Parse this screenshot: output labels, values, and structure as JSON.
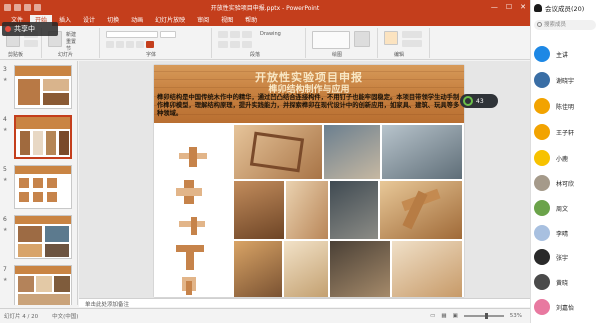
{
  "window": {
    "title": "开放性实验项目申报.pptx - PowerPoint",
    "controls": [
      "—",
      "☐",
      "✕"
    ]
  },
  "ribbon": {
    "tabs": [
      "文件",
      "开始",
      "插入",
      "设计",
      "切换",
      "动画",
      "幻灯片放映",
      "审阅",
      "视图",
      "帮助"
    ],
    "active_tab_index": 1,
    "group_labels": [
      "剪贴板",
      "幻灯片",
      "字体",
      "段落",
      "绘图",
      "编辑"
    ],
    "small_labels": [
      "新建",
      "重置",
      "节",
      "Drawing"
    ]
  },
  "live_badge": {
    "text": "共享中"
  },
  "thumbnails": [
    {
      "number": "3",
      "star": "★"
    },
    {
      "number": "4",
      "star": "★"
    },
    {
      "number": "5",
      "star": "★"
    },
    {
      "number": "6",
      "star": "★"
    },
    {
      "number": "7",
      "star": "★"
    }
  ],
  "slide": {
    "title_line1": "开放性实验项目申报",
    "title_line2": "榫卯结构制作与应用",
    "body": "榫卯结构是中国传统木作中的精华，通过凹凸结合连接构件，不用钉子也能牢固稳定。本项目带领学生动手制作榫卯模型，理解结构原理，提升实践能力，并探索榫卯在现代设计中的创新应用，如家具、建筑、玩具等多种领域。"
  },
  "clock": {
    "value": "43"
  },
  "notes": {
    "placeholder": "单击此处添加备注"
  },
  "status": {
    "left": "幻灯片 4 / 20",
    "language": "中文(中国)",
    "zoom": "53%"
  },
  "side_panel": {
    "title": "会议成员(20)",
    "search_placeholder": "搜索成员",
    "members": [
      {
        "name": "主讲",
        "color": "#1e88e5"
      },
      {
        "name": "谢晓宇",
        "color": "#3a6ea5"
      },
      {
        "name": "陈佳明",
        "color": "#f2a300"
      },
      {
        "name": "王子轩",
        "color": "#f2a300"
      },
      {
        "name": "小鹿",
        "color": "#f7c200"
      },
      {
        "name": "林可欣",
        "color": "#a59a8a"
      },
      {
        "name": "周文",
        "color": "#6ba34a"
      },
      {
        "name": "李晴",
        "color": "#a8c0e0"
      },
      {
        "name": "张宇",
        "color": "#2a2a2a"
      },
      {
        "name": "黄晓",
        "color": "#4a4a4a"
      },
      {
        "name": "刘嘉怡",
        "color": "#e879a0"
      }
    ]
  }
}
